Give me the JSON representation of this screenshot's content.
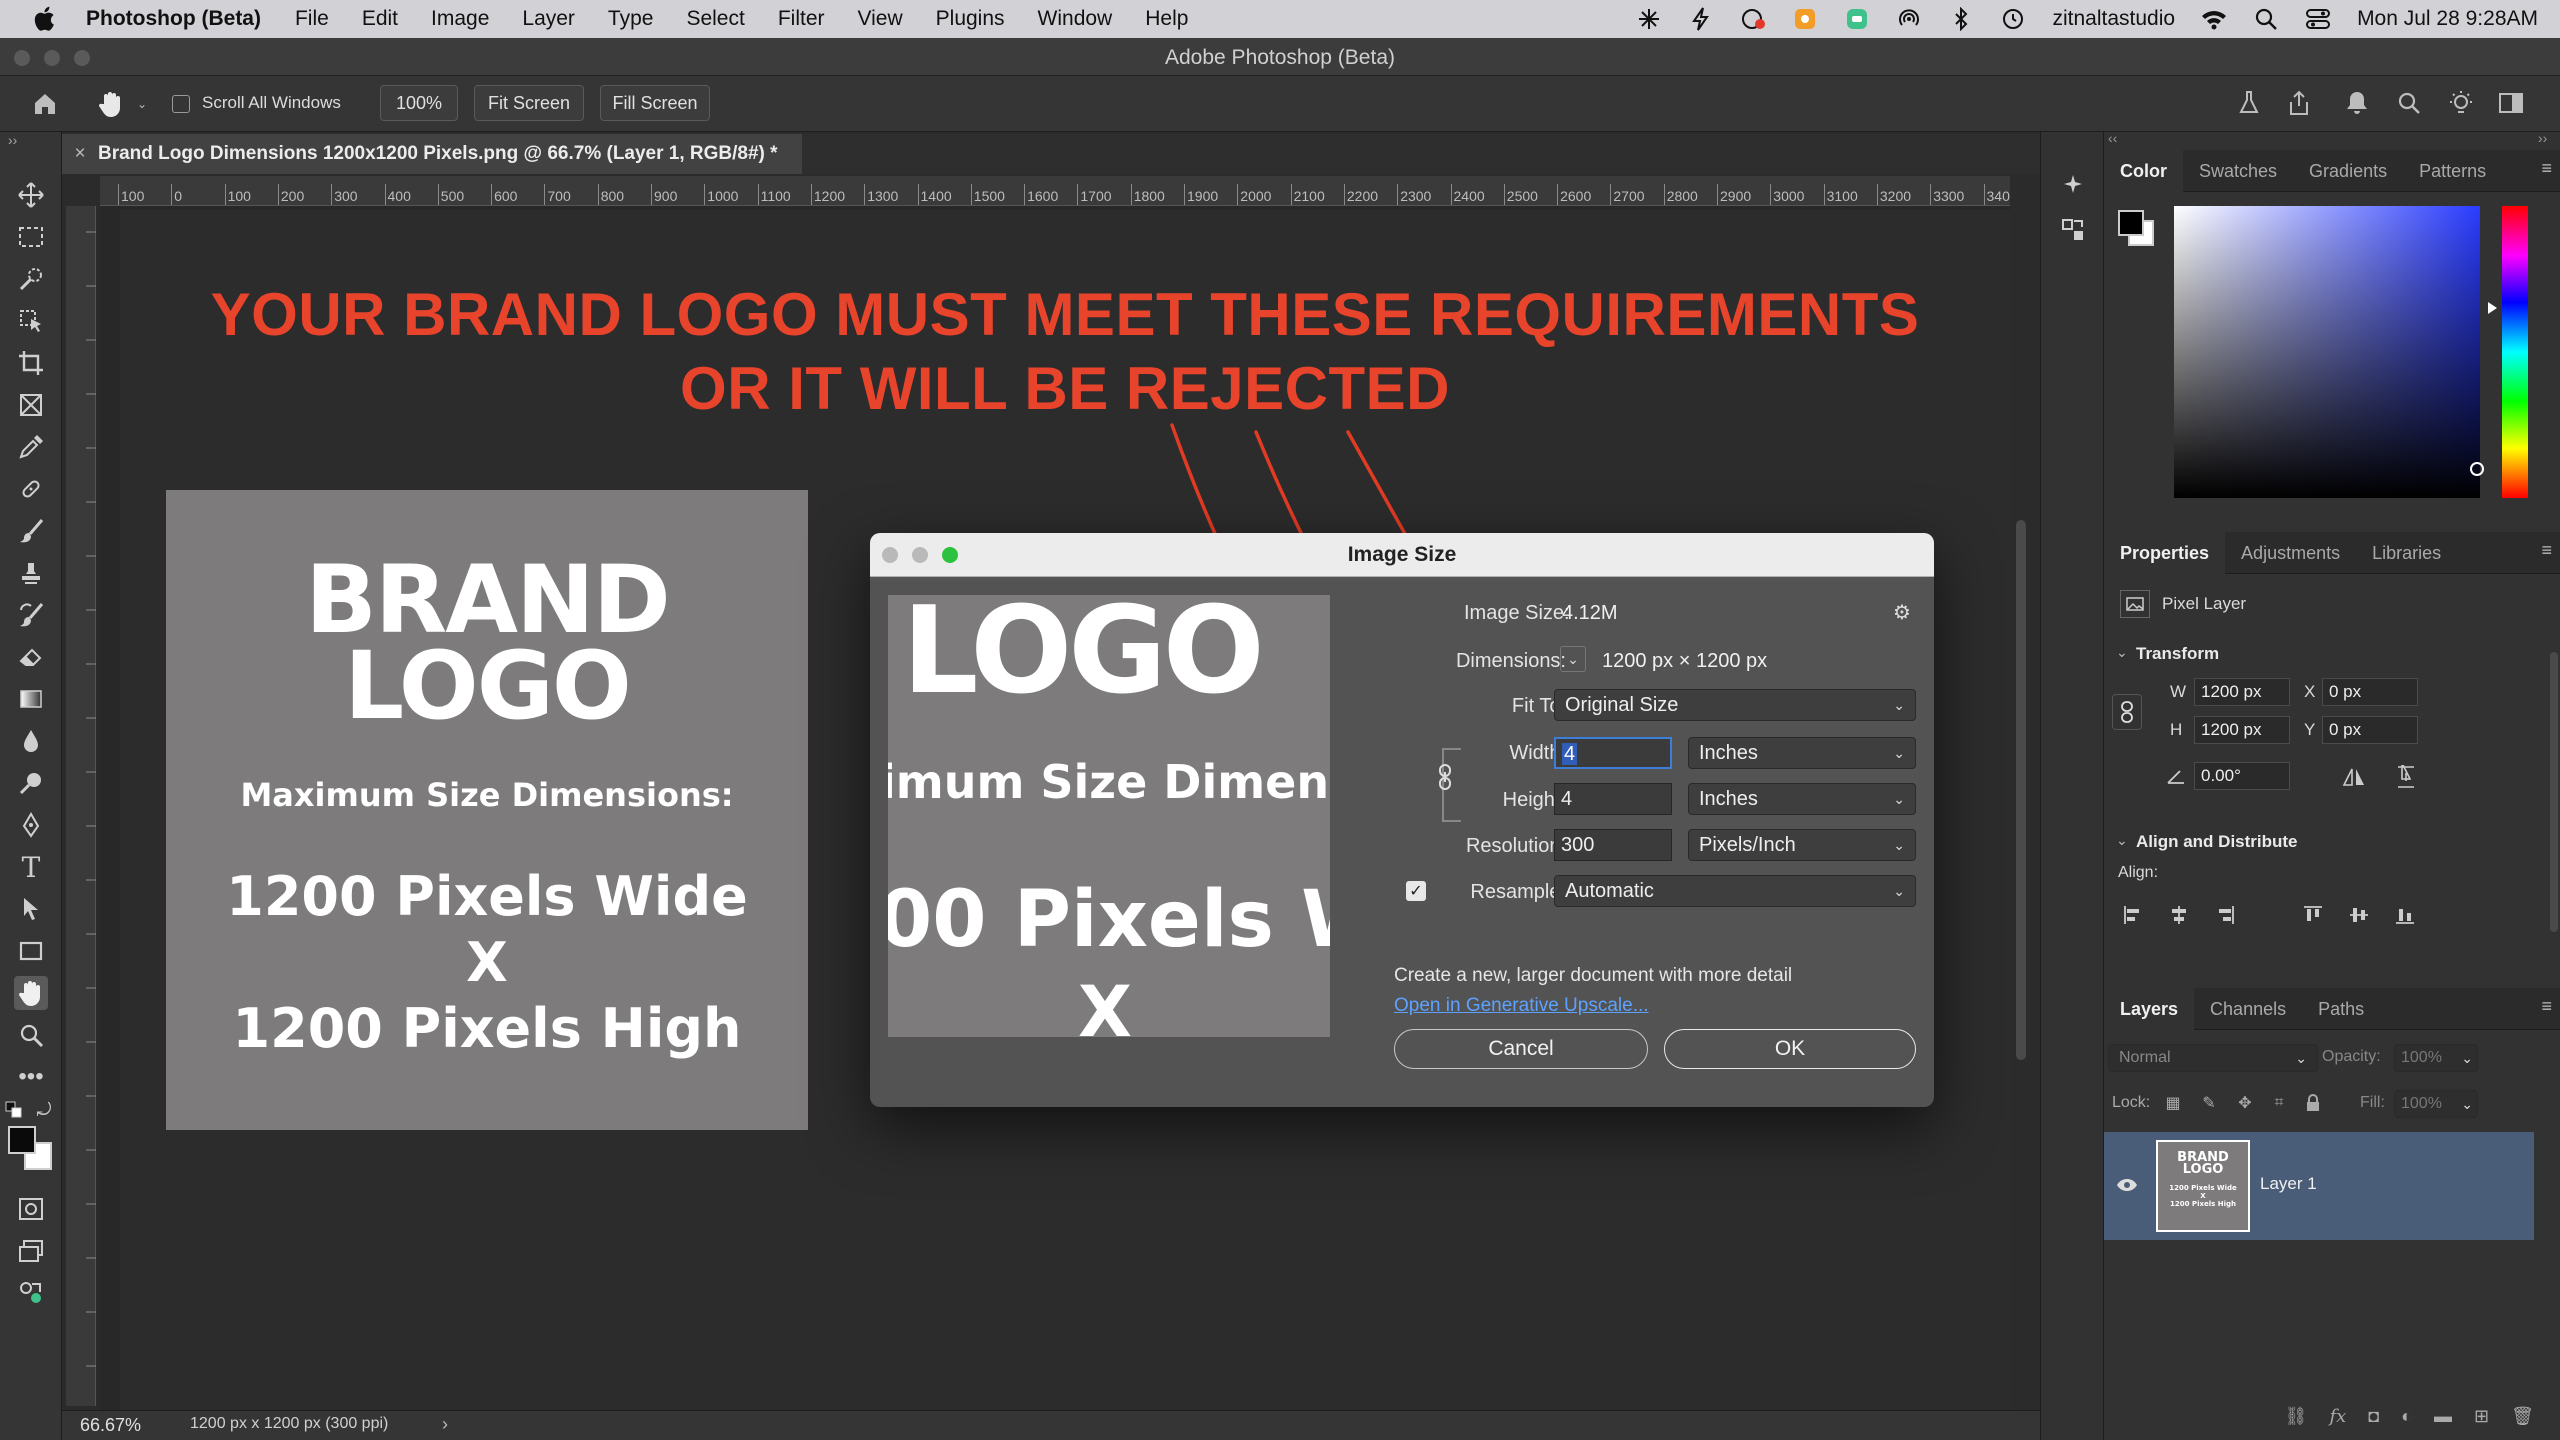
{
  "menubar": {
    "app_name": "Photoshop (Beta)",
    "items": [
      "File",
      "Edit",
      "Image",
      "Layer",
      "Type",
      "Select",
      "Filter",
      "View",
      "Plugins",
      "Window",
      "Help"
    ],
    "user": "zitnaltastudio",
    "clock": "Mon Jul 28  9:28AM"
  },
  "window": {
    "title": "Adobe Photoshop (Beta)"
  },
  "options": {
    "scroll_all_label": "Scroll All Windows",
    "zoom_label": "100%",
    "fit_screen_label": "Fit Screen",
    "fill_screen_label": "Fill Screen"
  },
  "document": {
    "tab_title": "Brand Logo Dimensions 1200x1200 Pixels.png @ 66.7% (Layer 1, RGB/8#) *",
    "close_glyph": "×"
  },
  "ruler": {
    "ticks": [
      "100",
      "0",
      "100",
      "200",
      "300",
      "400",
      "500",
      "600",
      "700",
      "800",
      "900",
      "1000",
      "1100",
      "1200",
      "1300",
      "1400",
      "1500",
      "1600",
      "1700",
      "1800",
      "1900",
      "2000",
      "2100",
      "2200",
      "2300",
      "2400",
      "2500",
      "2600",
      "2700",
      "2800",
      "2900",
      "3000",
      "3100",
      "3200",
      "3300",
      "340"
    ]
  },
  "canvas": {
    "headline_line1": "YOUR BRAND LOGO MUST MEET THESE REQUIREMENTS",
    "headline_line2": "OR IT WILL BE REJECTED",
    "headline_color": "#e8442c",
    "logo": {
      "line1": "BRAND",
      "line2": "LOGO",
      "subtitle": "Maximum Size Dimensions:",
      "width_text": "1200 Pixels Wide",
      "x_text": "X",
      "height_text": "1200 Pixels High"
    }
  },
  "dialog": {
    "title": "Image Size",
    "preview": {
      "line1": "LOGO",
      "line2": "imum Size Dimensi",
      "line3": "00 Pixels W",
      "line4": "X"
    },
    "image_size_label": "Image Size:",
    "image_size_value": "4.12M",
    "dimensions_label": "Dimensions:",
    "dimensions_value": "1200 px  ×  1200 px",
    "fit_to_label": "Fit To:",
    "fit_to_value": "Original Size",
    "width_label": "Width:",
    "width_value": "4",
    "width_unit": "Inches",
    "height_label": "Height:",
    "height_value": "4",
    "height_unit": "Inches",
    "resolution_label": "Resolution:",
    "resolution_value": "300",
    "resolution_unit": "Pixels/Inch",
    "resample_label": "Resample:",
    "resample_value": "Automatic",
    "resample_checked": true,
    "upscale_text": "Create a new, larger document with more detail",
    "upscale_link": "Open in Generative Upscale...",
    "cancel_label": "Cancel",
    "ok_label": "OK"
  },
  "status": {
    "zoom": "66.67%",
    "doc_info": "1200 px x 1200 px (300 ppi)"
  },
  "color_panel": {
    "tabs": [
      "Color",
      "Swatches",
      "Gradients",
      "Patterns"
    ],
    "hue_color": "#2a3cff"
  },
  "properties_panel": {
    "tabs": [
      "Properties",
      "Adjustments",
      "Libraries"
    ],
    "kind": "Pixel Layer",
    "transform_header": "Transform",
    "w_label": "W",
    "w_value": "1200 px",
    "h_label": "H",
    "h_value": "1200 px",
    "x_label": "X",
    "x_value": "0 px",
    "y_label": "Y",
    "y_value": "0 px",
    "angle_value": "0.00°",
    "align_header": "Align and Distribute",
    "align_label": "Align:"
  },
  "layers_panel": {
    "tabs": [
      "Layers",
      "Channels",
      "Paths"
    ],
    "blend_mode": "Normal",
    "opacity_label": "Opacity:",
    "opacity_value": "100%",
    "lock_label": "Lock:",
    "fill_label": "Fill:",
    "fill_value": "100%",
    "layer_name": "Layer 1",
    "thumb_line1": "BRAND",
    "thumb_line2": "LOGO",
    "thumb_text1": "1200 Pixels Wide",
    "thumb_text2": "X",
    "thumb_text3": "1200 Pixels High"
  }
}
